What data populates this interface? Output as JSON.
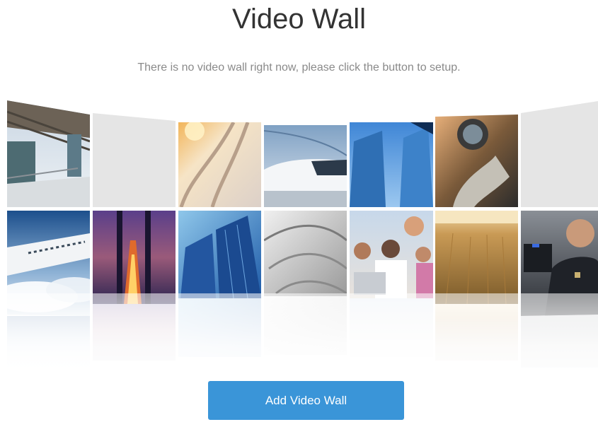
{
  "page": {
    "title": "Video Wall",
    "message": "There is no video wall right now, please click the button to setup."
  },
  "wall": {
    "tiles": [
      {
        "name": "tile-airport-terminal",
        "kind": "photo"
      },
      {
        "name": "tile-empty-1",
        "kind": "empty"
      },
      {
        "name": "tile-snow-road",
        "kind": "photo"
      },
      {
        "name": "tile-bullet-train",
        "kind": "photo"
      },
      {
        "name": "tile-glass-towers",
        "kind": "photo"
      },
      {
        "name": "tile-motorcyclist",
        "kind": "photo"
      },
      {
        "name": "tile-empty-2",
        "kind": "empty"
      },
      {
        "name": "tile-airplane-clouds",
        "kind": "photo"
      },
      {
        "name": "tile-bridge-night",
        "kind": "photo"
      },
      {
        "name": "tile-blue-skyscraper",
        "kind": "photo"
      },
      {
        "name": "tile-white-building",
        "kind": "photo"
      },
      {
        "name": "tile-family-laptop",
        "kind": "photo"
      },
      {
        "name": "tile-wheat-field",
        "kind": "photo"
      },
      {
        "name": "tile-police-officer",
        "kind": "photo"
      }
    ]
  },
  "actions": {
    "add_label": "Add Video Wall"
  },
  "colors": {
    "accent": "#3a95d8",
    "title": "#333333",
    "message": "#8a8a8a",
    "empty_tile": "#e5e5e5"
  }
}
